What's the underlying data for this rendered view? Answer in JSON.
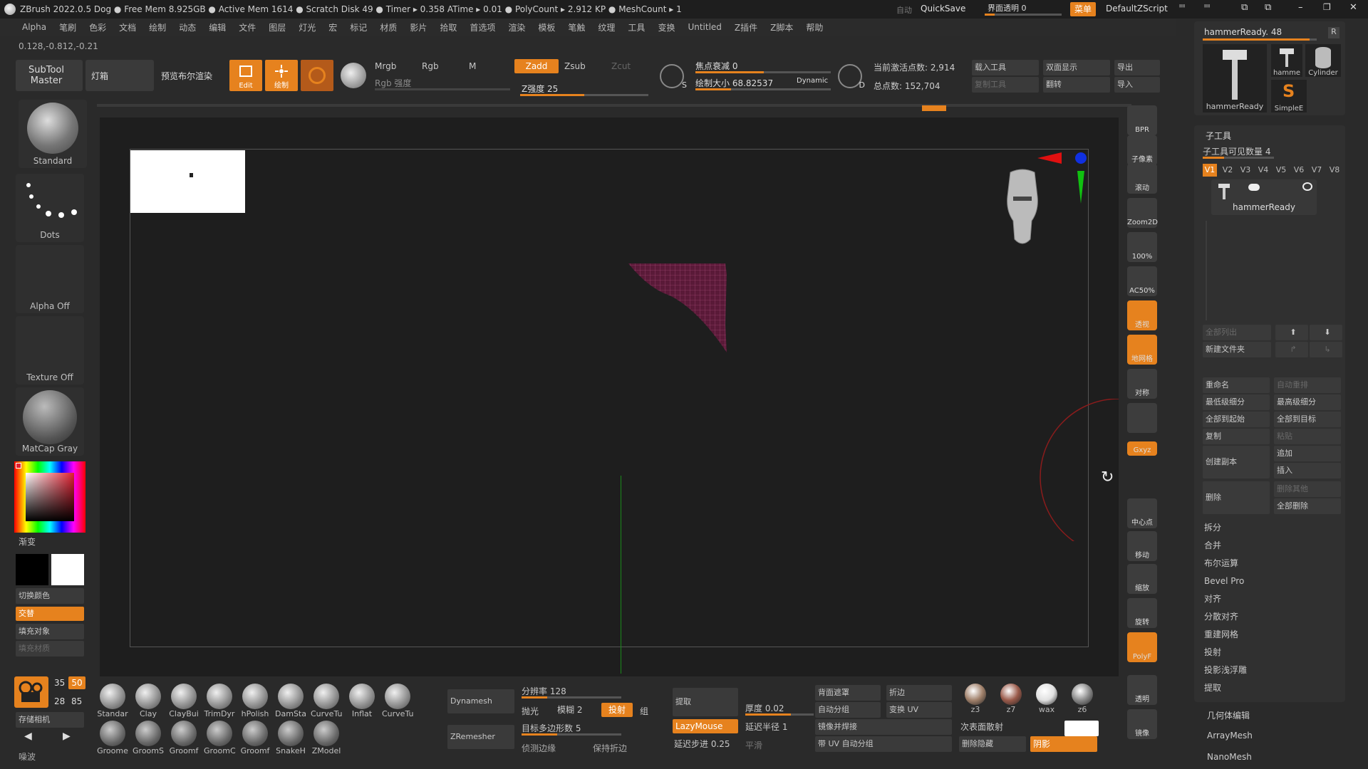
{
  "titlebar": {
    "text": "ZBrush 2022.0.5  Dog  ● Free Mem 8.925GB ● Active Mem 1614 ● Scratch Disk 49 ● Timer ▸ 0.358 ATime ▸ 0.01 ● PolyCount ▸ 2.912 KP ● MeshCount ▸ 1",
    "autosave": "自动",
    "quicksave": "QuickSave",
    "ui_transparency": "界面透明 0",
    "menu_btn": "菜单",
    "script": "DefaultZScript"
  },
  "menubar": [
    "Alpha",
    "笔刷",
    "色彩",
    "文档",
    "绘制",
    "动态",
    "编辑",
    "文件",
    "图层",
    "灯光",
    "宏",
    "标记",
    "材质",
    "影片",
    "拾取",
    "首选项",
    "渲染",
    "模板",
    "笔触",
    "纹理",
    "工具",
    "变换",
    "Untitled",
    "Z插件",
    "Z脚本",
    "帮助"
  ],
  "coords": "0.128,-0.812,-0.21",
  "toolbar": {
    "subtool_master": "SubTool Master",
    "lightbox": "灯箱",
    "preview_bool": "预览布尔渲染",
    "edit": "Edit",
    "draw": "绘制",
    "mrgb": "Mrgb",
    "rgb": "Rgb",
    "m": "M",
    "rgb_intensity": "Rgb 强度",
    "zadd": "Zadd",
    "zsub": "Zsub",
    "zcut": "Zcut",
    "z_intensity": "Z强度 25",
    "s": "S",
    "focal_shift": "焦点衰减 0",
    "draw_size": "绘制大小 68.82537",
    "dynamic": "Dynamic",
    "d": "D",
    "active_points": "当前激活点数: 2,914",
    "total_points": "总点数: 152,704",
    "load_tool": "载入工具",
    "double_side": "双面显示",
    "export": "导出",
    "copy_tool": "复制工具",
    "flip": "翻转",
    "import": "导入"
  },
  "left_shelf": {
    "brush": "Standard",
    "stroke": "Dots",
    "alpha": "Alpha Off",
    "texture": "Texture Off",
    "material": "MatCap Gray",
    "gradient": "渐变",
    "switch_color": "切换颜色",
    "alternate": "交替",
    "fill_object": "填充对象",
    "fill_material": "填充材质"
  },
  "right_strip": [
    "BPR",
    "子像素",
    "滚动",
    "Zoom2D",
    "100%",
    "AC50%",
    "透视",
    "地网格",
    "对称",
    "",
    "Gxyz",
    "",
    "",
    "中心点",
    "移动",
    "缩放",
    "旋转",
    "PolyF",
    "透明",
    "镜像"
  ],
  "rpanel": {
    "hammer_ready": "hammerReady. 48",
    "r": "R",
    "thumb1": "hammerReady",
    "thumb2": "hamme",
    "thumb3": "Cylinder",
    "thumb4": "SimpleE",
    "subtool": "子工具",
    "visible_count": "子工具可见数量 4",
    "versions": [
      "V1",
      "V2",
      "V3",
      "V4",
      "V5",
      "V6",
      "V7",
      "V8"
    ],
    "subtool_name": "hammerReady",
    "list_all": "全部列出",
    "new_folder": "新建文件夹",
    "rename": "重命名",
    "auto_reorder": "自动重排",
    "lowest_subdiv": "最低级细分",
    "highest_subdiv": "最高级细分",
    "all_to_start": "全部到起始",
    "all_to_target": "全部到目标",
    "duplicate": "复制",
    "paste": "粘贴",
    "create_copy": "创建副本",
    "append": "追加",
    "insert": "插入",
    "delete": "删除",
    "delete_others": "删除其他",
    "delete_all": "全部删除",
    "items": [
      "拆分",
      "合并",
      "布尔运算",
      "Bevel Pro",
      "对齐",
      "分散对齐",
      "重建网格",
      "投射",
      "投影浅浮雕",
      "提取"
    ],
    "geometry_edit": "几何体编辑",
    "array_mesh": "ArrayMesh",
    "nano_mesh": "NanoMesh"
  },
  "bottom": {
    "brushes_row1": [
      "Standar",
      "Clay",
      "ClayBui",
      "TrimDyr",
      "hPolish",
      "DamSta",
      "CurveTu",
      "Inflat",
      "CurveTu"
    ],
    "brushes_row2": [
      "Groome",
      "GroomS",
      "Groomf",
      "GroomC",
      "Groomf",
      "SnakeH",
      "ZModel"
    ],
    "camera_label": "存储相机",
    "num35": "35",
    "num50": "50",
    "num28": "28",
    "num85": "85",
    "noise": "噪波",
    "dynamesh": "Dynamesh",
    "resolution": "分辨率 128",
    "polish": "抛光",
    "blur": "模糊 2",
    "project": "投射",
    "group": "组",
    "zremesher": "ZRemesher",
    "target_poly": "目标多边形数 5",
    "detect_edges": "侦测边缘",
    "keep_creases": "保持折边",
    "extract": "提取",
    "thickness": "厚度 0.02",
    "lazymouse": "LazyMouse",
    "lazy_radius": "延迟半径 1",
    "lazy_step": "延迟步进 0.25",
    "smooth": "平滑",
    "backface": "背面遮罩",
    "auto_group": "自动分组",
    "mirror_weld": "镜像并焊接",
    "uv_autogroup": "带 UV 自动分组",
    "crease": "折边",
    "transfer_uv": "变换 UV",
    "next_scatter": "次表面散射",
    "delete_hidden": "删除隐藏",
    "shadow": "阴影",
    "materials": [
      "z3",
      "z7",
      "wax",
      "z6"
    ]
  }
}
